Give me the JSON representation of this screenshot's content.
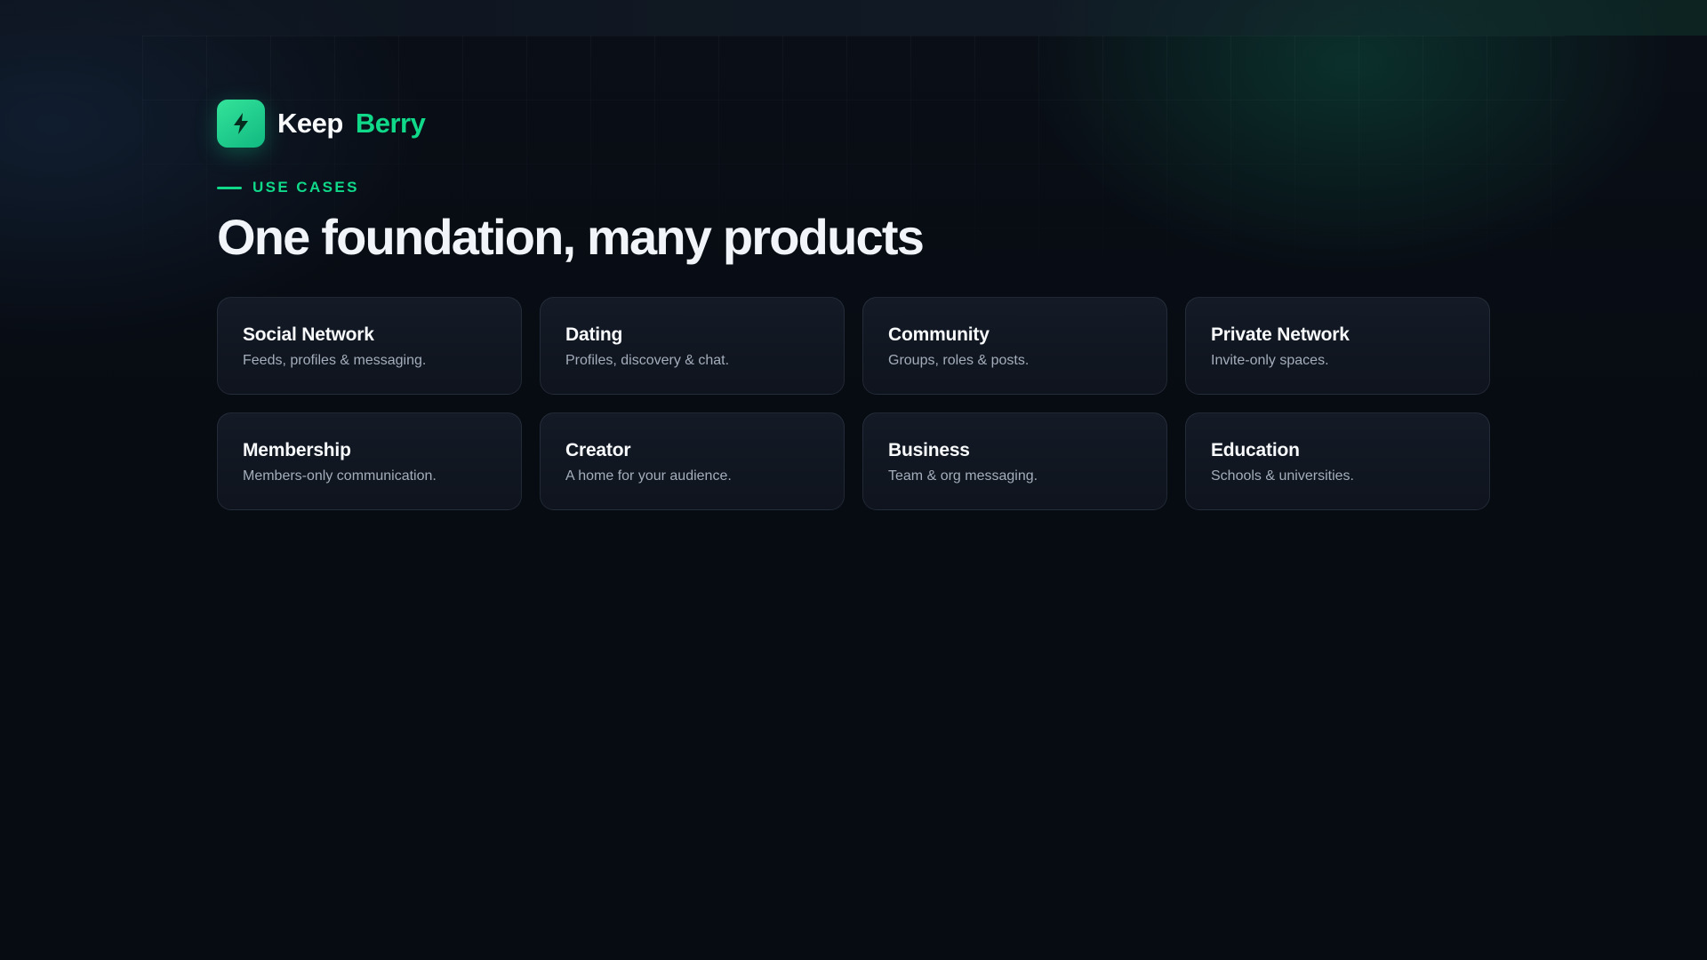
{
  "brand": {
    "name_part1": "Keep",
    "name_part2": "Berry",
    "icon": "lightning-bolt-icon",
    "accent_color": "#10d98a"
  },
  "section": {
    "eyebrow": "USE CASES",
    "headline": "One foundation, many products"
  },
  "use_cases": [
    {
      "title": "Social Network",
      "description": "Feeds, profiles & messaging."
    },
    {
      "title": "Dating",
      "description": "Profiles, discovery & chat."
    },
    {
      "title": "Community",
      "description": "Groups, roles & posts."
    },
    {
      "title": "Private Network",
      "description": "Invite-only spaces."
    },
    {
      "title": "Membership",
      "description": "Members-only communication."
    },
    {
      "title": "Creator",
      "description": "A home for your audience."
    },
    {
      "title": "Business",
      "description": "Team & org messaging."
    },
    {
      "title": "Education",
      "description": "Schools & universities."
    }
  ]
}
